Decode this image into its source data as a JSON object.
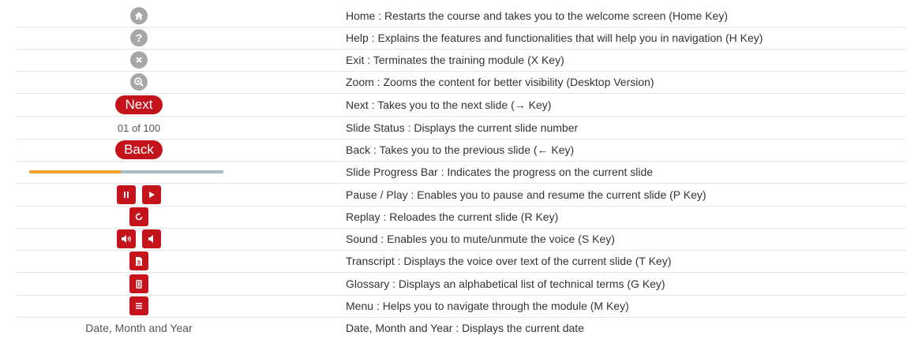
{
  "rows": [
    {
      "icon": "home-icon",
      "desc": "Home : Restarts the course and takes you to the welcome screen (Home Key)"
    },
    {
      "icon": "help-icon",
      "desc": "Help : Explains the features and functionalities that will help you in navigation (H Key)"
    },
    {
      "icon": "close-icon",
      "desc": "Exit : Terminates the training module (X Key)"
    },
    {
      "icon": "zoom-icon",
      "desc": "Zoom : Zooms the content for better visibility (Desktop Version)"
    },
    {
      "label": "Next",
      "desc": "Next : Takes you to the next slide (→ Key)"
    },
    {
      "label": "01 of 100",
      "desc": "Slide Status : Displays the current slide number"
    },
    {
      "label": "Back",
      "desc": "Back : Takes you to the previous slide (← Key)"
    },
    {
      "progress": 0.47,
      "desc": "Slide Progress Bar : Indicates the progress on the current slide"
    },
    {
      "icons": [
        "pause-icon",
        "play-icon"
      ],
      "desc": "Pause / Play : Enables you to pause and resume the current slide (P Key)"
    },
    {
      "icon": "replay-icon",
      "desc": "Replay : Reloades the current slide (R Key)"
    },
    {
      "icons": [
        "sound-on-icon",
        "sound-off-icon"
      ],
      "desc": "Sound : Enables you to mute/unmute the voice (S Key)"
    },
    {
      "icon": "transcript-icon",
      "desc": "Transcript : Displays the voice over text of the current slide (T Key)"
    },
    {
      "icon": "glossary-icon",
      "desc": "Glossary : Displays an alphabetical list of technical terms (G Key)"
    },
    {
      "icon": "menu-icon",
      "desc": "Menu : Helps you to navigate through the module (M Key)"
    },
    {
      "label": "Date, Month and Year",
      "desc": "Date, Month and Year : Displays the current date"
    }
  ],
  "colors": {
    "accent": "#c4131b",
    "gray_icon": "#a7a7a7",
    "progress_fill": "#f0a22b",
    "progress_track": "#a8bcc6"
  }
}
